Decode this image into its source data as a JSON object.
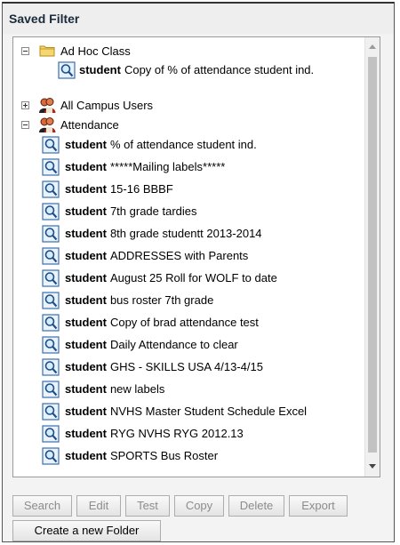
{
  "panel": {
    "title": "Saved Filter"
  },
  "tree": {
    "groups": [
      {
        "label": "Ad Hoc Class",
        "expanded": true,
        "icon": "folder-icon",
        "items": [
          {
            "bold": "student",
            "text": "Copy of % of attendance student ind."
          }
        ]
      },
      {
        "label": "All Campus Users",
        "expanded": false,
        "icon": "user-group-icon"
      },
      {
        "label": "Attendance",
        "expanded": true,
        "icon": "user-group-icon",
        "items": [
          {
            "bold": "student",
            "text": "% of attendance student ind."
          },
          {
            "bold": "student",
            "text": "*****Mailing labels*****"
          },
          {
            "bold": "student",
            "text": "15-16 BBBF"
          },
          {
            "bold": "student",
            "text": "7th grade tardies"
          },
          {
            "bold": "student",
            "text": "8th grade studentt 2013-2014"
          },
          {
            "bold": "student",
            "text": "ADDRESSES with Parents"
          },
          {
            "bold": "student",
            "text": "August 25 Roll for WOLF to date"
          },
          {
            "bold": "student",
            "text": "bus roster 7th grade"
          },
          {
            "bold": "student",
            "text": "Copy of brad attendance test"
          },
          {
            "bold": "student",
            "text": "Daily Attendance to clear"
          },
          {
            "bold": "student",
            "text": "GHS - SKILLS USA 4/13-4/15"
          },
          {
            "bold": "student",
            "text": "new labels"
          },
          {
            "bold": "student",
            "text": "NVHS Master Student Schedule Excel"
          },
          {
            "bold": "student",
            "text": "RYG NVHS RYG 2012.13"
          },
          {
            "bold": "student",
            "text": "SPORTS Bus Roster"
          }
        ]
      }
    ]
  },
  "buttons": {
    "search": "Search",
    "edit": "Edit",
    "test": "Test",
    "copy": "Copy",
    "delete": "Delete",
    "export": "Export",
    "create_folder": "Create a new Folder"
  },
  "colors": {
    "header_text": "#1a2a3a",
    "disabled_text": "#8c8c8c"
  }
}
